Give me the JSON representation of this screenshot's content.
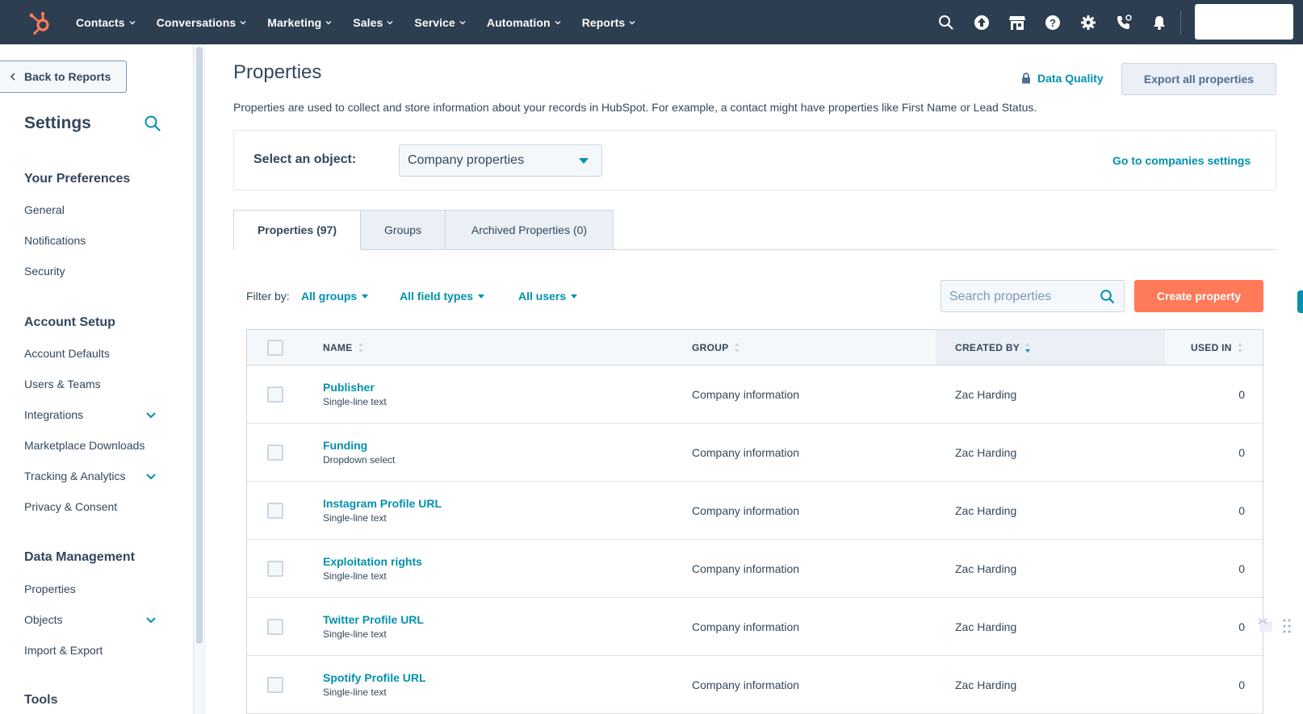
{
  "topnav": {
    "items": [
      "Contacts",
      "Conversations",
      "Marketing",
      "Sales",
      "Service",
      "Automation",
      "Reports"
    ],
    "icons": [
      "search-icon",
      "upgrade-icon",
      "marketplace-icon",
      "help-icon",
      "settings-icon",
      "calling-icon",
      "notifications-icon"
    ]
  },
  "sidebar": {
    "back_label": "Back to Reports",
    "title": "Settings",
    "sections": [
      {
        "title": "Your Preferences",
        "items": [
          "General",
          "Notifications",
          "Security"
        ]
      },
      {
        "title": "Account Setup",
        "items": [
          "Account Defaults",
          "Users & Teams",
          "Integrations",
          "Marketplace Downloads",
          "Tracking & Analytics",
          "Privacy & Consent"
        ]
      },
      {
        "title": "Data Management",
        "items": [
          "Properties",
          "Objects",
          "Import & Export"
        ]
      },
      {
        "title": "Tools",
        "items": []
      }
    ]
  },
  "main": {
    "title": "Properties",
    "data_quality": "Data Quality",
    "export_label": "Export all properties",
    "description": "Properties are used to collect and store information about your records in HubSpot. For example, a contact might have properties like First Name or Lead Status.",
    "object_label": "Select an object:",
    "object_value": "Company properties",
    "goto_label": "Go to companies settings",
    "tabs": [
      "Properties (97)",
      "Groups",
      "Archived Properties (0)"
    ],
    "filter_label": "Filter by:",
    "filters": [
      "All groups",
      "All field types",
      "All users"
    ],
    "search_placeholder": "Search properties",
    "create_label": "Create property"
  },
  "table": {
    "columns": {
      "name": "NAME",
      "group": "GROUP",
      "created_by": "CREATED BY",
      "used_in": "USED IN"
    },
    "rows": [
      {
        "name": "Publisher",
        "type": "Single-line text",
        "group": "Company information",
        "created_by": "Zac Harding",
        "used_in": "0"
      },
      {
        "name": "Funding",
        "type": "Dropdown select",
        "group": "Company information",
        "created_by": "Zac Harding",
        "used_in": "0"
      },
      {
        "name": "Instagram Profile URL",
        "type": "Single-line text",
        "group": "Company information",
        "created_by": "Zac Harding",
        "used_in": "0"
      },
      {
        "name": "Exploitation rights",
        "type": "Single-line text",
        "group": "Company information",
        "created_by": "Zac Harding",
        "used_in": "0"
      },
      {
        "name": "Twitter Profile URL",
        "type": "Single-line text",
        "group": "Company information",
        "created_by": "Zac Harding",
        "used_in": "0"
      },
      {
        "name": "Spotify Profile URL",
        "type": "Single-line text",
        "group": "Company information",
        "created_by": "Zac Harding",
        "used_in": "0"
      }
    ]
  },
  "colors": {
    "nav_bg": "#2d3e50",
    "accent": "#0091ae",
    "primary_button": "#ff7a59",
    "text": "#33475b"
  }
}
